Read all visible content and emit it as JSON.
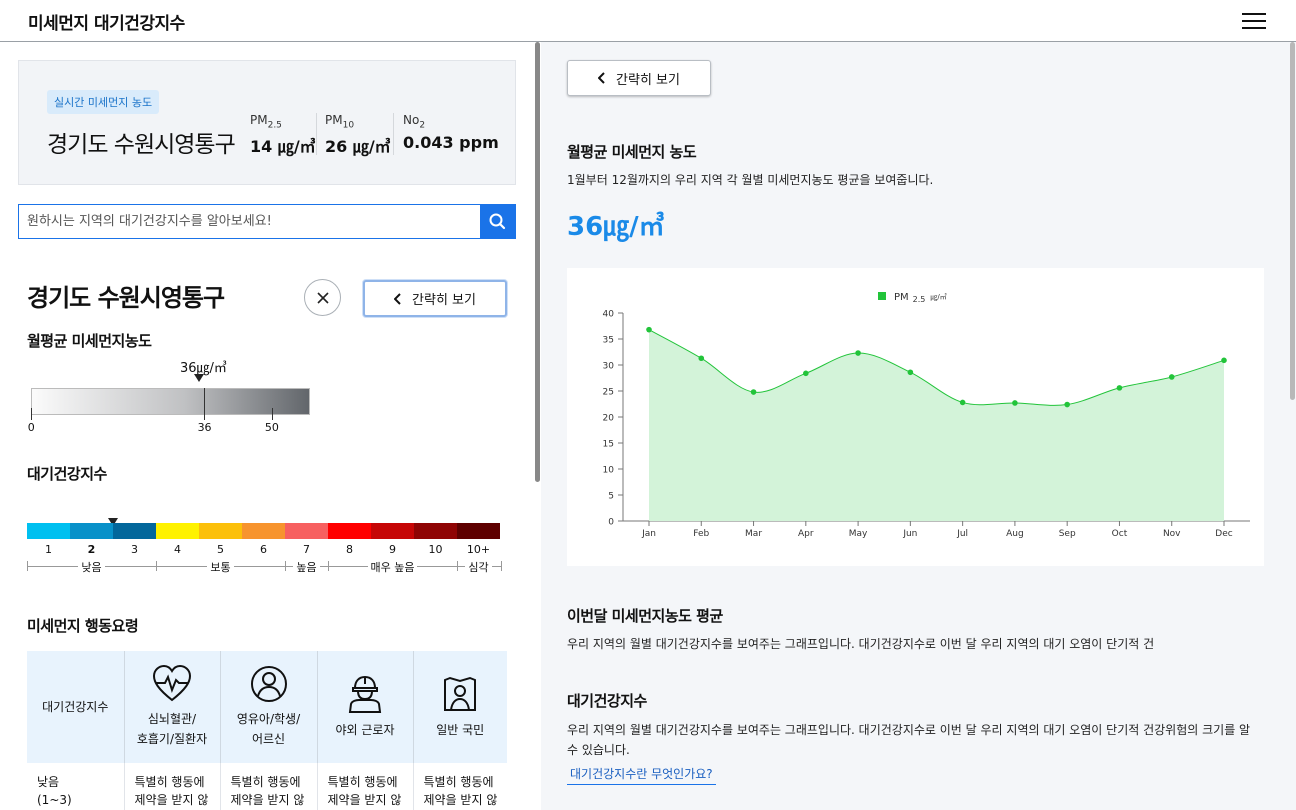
{
  "app": {
    "title": "미세먼지 대기건강지수"
  },
  "realtime": {
    "tag": "실시간 미세먼지 농도",
    "region": "경기도 수원시영통구",
    "metrics": [
      {
        "label": "PM",
        "sub": "2.5",
        "value": "14 ㎍/㎥"
      },
      {
        "label": "PM",
        "sub": "10",
        "value": "26 ㎍/㎥"
      },
      {
        "label": "No",
        "sub": "2",
        "value": "0.043 ppm"
      }
    ]
  },
  "search": {
    "placeholder": "원하시는 지역의 대기건강지수를 알아보세요!"
  },
  "detail": {
    "region": "경기도 수원시영통구",
    "brief_label": "간략히 보기",
    "monthly_label": "월평균 미세먼지농도",
    "gauge": {
      "value_label": "36㎍/㎥",
      "value": 36,
      "min": 0,
      "max": 58,
      "ticks": [
        "0",
        "36",
        "50"
      ]
    },
    "index_label": "대기건강지수",
    "index_scale": {
      "levels": [
        "1",
        "2",
        "3",
        "4",
        "5",
        "6",
        "7",
        "8",
        "9",
        "10",
        "10+"
      ],
      "colors": [
        "#00c0f0",
        "#0891c9",
        "#03679b",
        "#fff200",
        "#fcc00a",
        "#f7942e",
        "#f76060",
        "#ff0000",
        "#c60606",
        "#8f0404",
        "#5e0000"
      ],
      "selected": "2",
      "categories": [
        "낮음",
        "보통",
        "높음",
        "매우 높음",
        "심각"
      ]
    },
    "action_label": "미세먼지 행동요령",
    "action_table": {
      "headers": [
        "대기건강지수",
        "심뇌혈관/\n호흡기/질환자",
        "영유아/학생/\n어르신",
        "야외 근로자",
        "일반 국민"
      ],
      "header_icons": [
        "",
        "heart-pulse-icon",
        "person-icon",
        "worker-icon",
        "flag-person-icon"
      ],
      "row": [
        "낮음\n(1~3)",
        "특별히 행동에\n제약을 받지 않",
        "특별히 행동에\n제약을 받지 않",
        "특별히 행동에\n제약을 받지 않",
        "특별히 행동에\n제약을 받지 않"
      ]
    }
  },
  "right": {
    "brief_label": "간략히 보기",
    "monthly_title": "월평균 미세먼지 농도",
    "monthly_desc": "1월부터 12월까지의 우리 지역 각 월별 미세먼지농도 평균을 보여줍니다.",
    "monthly_value": "36㎍/㎥",
    "month_avg_title": "이번달 미세먼지농도 평균",
    "month_avg_desc": "우리 지역의 월별 대기건강지수를 보여주는 그래프입니다. 대기건강지수로 이번 달 우리 지역의 대기 오염이 단기적 건",
    "index_title": "대기건강지수",
    "index_desc": "우리 지역의 월별 대기건강지수를 보여주는 그래프입니다. 대기건강지수로 이번 달 우리 지역의 대기 오염이 단기적 건강위험의 크기를 알 수 있습니다.",
    "link": "대기건강지수란 무엇인가요?"
  },
  "chart_data": {
    "type": "area",
    "x": [
      "Jan",
      "Feb",
      "Mar",
      "Apr",
      "May",
      "Jun",
      "Jul",
      "Aug",
      "Sep",
      "Oct",
      "Nov",
      "Dec"
    ],
    "series": [
      {
        "name": "PM 2.5 ㎍/㎥",
        "values": [
          36.8,
          31.3,
          24.8,
          28.4,
          32.3,
          28.6,
          22.8,
          22.7,
          22.4,
          25.6,
          27.7,
          30.9
        ],
        "color": "#22c43a",
        "fill": "#d3f3d9"
      }
    ],
    "legend": {
      "label": "PM",
      "sub": "2.5",
      "unit": "㎍/㎥",
      "position": "top-center"
    },
    "ylim": [
      0,
      40
    ],
    "yticks": [
      "0",
      "5",
      "10",
      "15",
      "20",
      "25",
      "30",
      "35",
      "40"
    ],
    "grid": false
  }
}
